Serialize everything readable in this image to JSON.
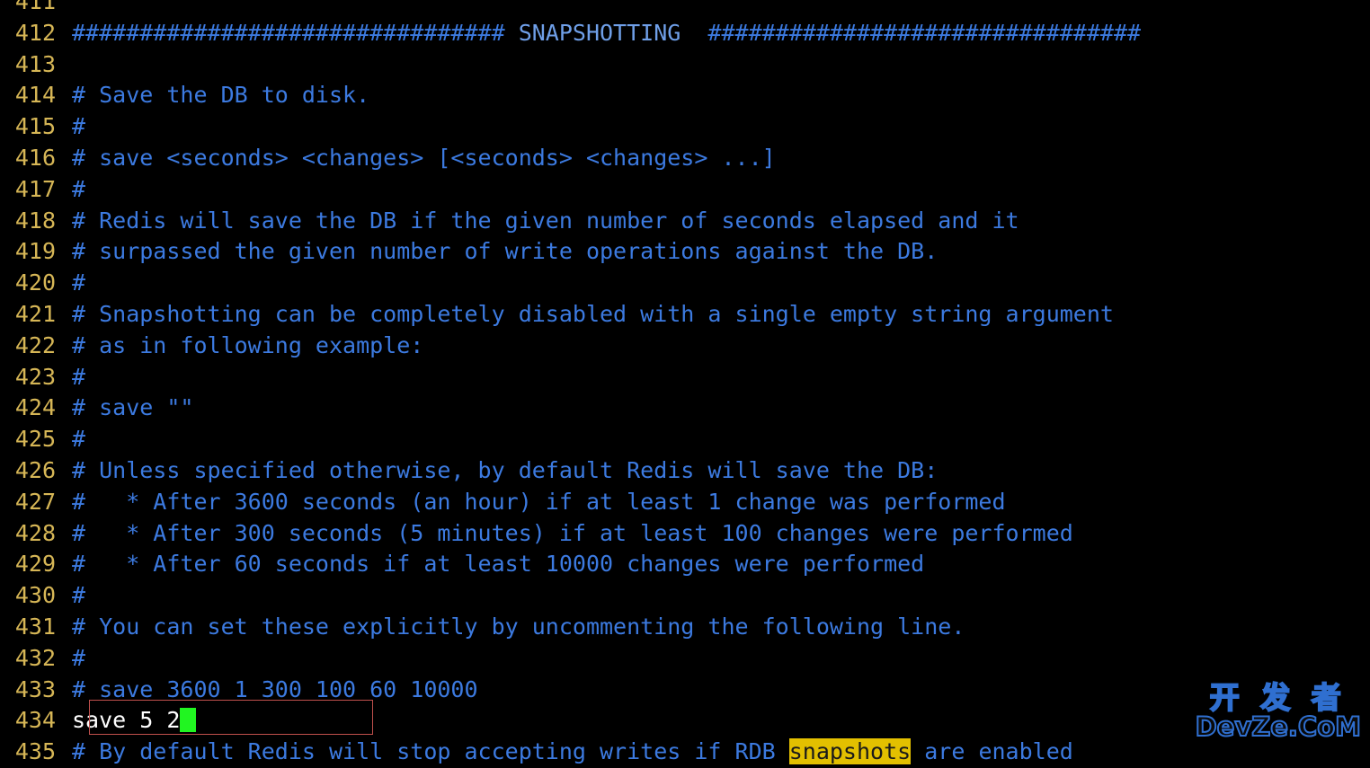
{
  "editor": {
    "kind": "terminal-text-editor",
    "file_context": "redis configuration file",
    "background_color": "#000000",
    "gutter_color": "#d6b656",
    "comment_color": "#3c7ae0",
    "active_text_color": "#ffffff",
    "cursor_color": "#21f521",
    "highlight_color": "#e3c000",
    "annotation_color": "#c0504d",
    "first_visible_line": "411",
    "last_visible_line": "435"
  },
  "lines": [
    {
      "num": "411",
      "segments": [
        {
          "text": "",
          "style": "comment"
        }
      ]
    },
    {
      "num": "412",
      "segments": [
        {
          "text": "################################",
          "style": "comment"
        },
        {
          "text": " SNAPSHOTTING  ",
          "style": "banner"
        },
        {
          "text": "################################",
          "style": "comment"
        }
      ]
    },
    {
      "num": "413",
      "segments": [
        {
          "text": "",
          "style": "comment"
        }
      ]
    },
    {
      "num": "414",
      "segments": [
        {
          "text": "# Save the DB to disk.",
          "style": "comment"
        }
      ]
    },
    {
      "num": "415",
      "segments": [
        {
          "text": "#",
          "style": "comment"
        }
      ]
    },
    {
      "num": "416",
      "segments": [
        {
          "text": "# save <seconds> <changes> [<seconds> <changes> ...]",
          "style": "comment"
        }
      ]
    },
    {
      "num": "417",
      "segments": [
        {
          "text": "#",
          "style": "comment"
        }
      ]
    },
    {
      "num": "418",
      "segments": [
        {
          "text": "# Redis will save the DB if the given number of seconds elapsed and it",
          "style": "comment"
        }
      ]
    },
    {
      "num": "419",
      "segments": [
        {
          "text": "# surpassed the given number of write operations against the DB.",
          "style": "comment"
        }
      ]
    },
    {
      "num": "420",
      "segments": [
        {
          "text": "#",
          "style": "comment"
        }
      ]
    },
    {
      "num": "421",
      "segments": [
        {
          "text": "# Snapshotting can be completely disabled with a single empty string argument",
          "style": "comment"
        }
      ]
    },
    {
      "num": "422",
      "segments": [
        {
          "text": "# as in following example:",
          "style": "comment"
        }
      ]
    },
    {
      "num": "423",
      "segments": [
        {
          "text": "#",
          "style": "comment"
        }
      ]
    },
    {
      "num": "424",
      "segments": [
        {
          "text": "# save \"\"",
          "style": "comment"
        }
      ]
    },
    {
      "num": "425",
      "segments": [
        {
          "text": "#",
          "style": "comment"
        }
      ]
    },
    {
      "num": "426",
      "segments": [
        {
          "text": "# Unless specified otherwise, by default Redis will save the DB:",
          "style": "comment"
        }
      ]
    },
    {
      "num": "427",
      "segments": [
        {
          "text": "#   * After 3600 seconds (an hour) if at least 1 change was performed",
          "style": "comment"
        }
      ]
    },
    {
      "num": "428",
      "segments": [
        {
          "text": "#   * After 300 seconds (5 minutes) if at least 100 changes were performed",
          "style": "comment"
        }
      ]
    },
    {
      "num": "429",
      "segments": [
        {
          "text": "#   * After 60 seconds if at least 10000 changes were performed",
          "style": "comment"
        }
      ]
    },
    {
      "num": "430",
      "segments": [
        {
          "text": "#",
          "style": "comment"
        }
      ]
    },
    {
      "num": "431",
      "segments": [
        {
          "text": "# You can set these explicitly by uncommenting the following line.",
          "style": "comment"
        }
      ]
    },
    {
      "num": "432",
      "segments": [
        {
          "text": "#",
          "style": "comment"
        }
      ]
    },
    {
      "num": "433",
      "segments": [
        {
          "text": "# save 3600 1 300 100 60 10000",
          "style": "comment"
        }
      ]
    },
    {
      "num": "434",
      "segments": [
        {
          "text": "save 5 2",
          "style": "active"
        },
        {
          "text": "",
          "style": "cursor"
        }
      ]
    },
    {
      "num": "435",
      "segments": [
        {
          "text": "# By default Redis will stop accepting writes if RDB ",
          "style": "comment"
        },
        {
          "text": "snapshots",
          "style": "highlight"
        },
        {
          "text": " are enabled",
          "style": "comment"
        }
      ]
    }
  ],
  "annotation": {
    "label": "edited-line-callout",
    "target_line": "434",
    "target_text": "save 5 2"
  },
  "watermark": {
    "chinese": "开 发 者",
    "latin": "DevZe.CoM"
  }
}
